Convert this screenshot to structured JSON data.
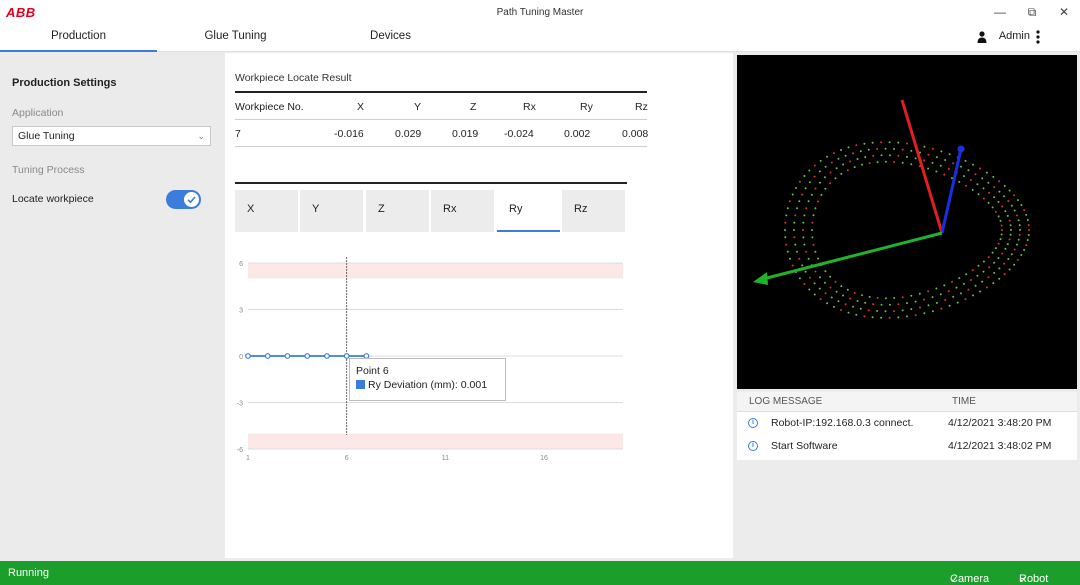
{
  "app": {
    "logo": "ABB",
    "title": "Path Tuning Master"
  },
  "window_controls": {
    "minimize": "—",
    "restore": "⧉",
    "close": "✕"
  },
  "tabs": [
    {
      "label": "Production"
    },
    {
      "label": "Glue Tuning"
    },
    {
      "label": "Devices"
    }
  ],
  "user": {
    "name": "Admin"
  },
  "left": {
    "title": "Production Settings",
    "application_label": "Application",
    "application_value": "Glue Tuning",
    "tuning_label": "Tuning Process",
    "locate_label": "Locate workpiece",
    "locate_on": true
  },
  "result": {
    "title": "Workpiece Locate Result",
    "headers": [
      "Workpiece No.",
      "X",
      "Y",
      "Z",
      "Rx",
      "Ry",
      "Rz"
    ],
    "row": [
      "7",
      "-0.016",
      "0.029",
      "0.019",
      "-0.024",
      "0.002",
      "0.008"
    ]
  },
  "axis_tabs": [
    "X",
    "Y",
    "Z",
    "Rx",
    "Ry",
    "Rz"
  ],
  "axis_tab_active": "Ry",
  "chart_data": {
    "type": "line",
    "series": [
      {
        "name": "Ry Deviation (mm)",
        "values": [
          0,
          0,
          0,
          0,
          0,
          0.001,
          0
        ]
      }
    ],
    "x": [
      1,
      2,
      3,
      4,
      5,
      6,
      7
    ],
    "xticks": [
      "1",
      "6",
      "11",
      "16"
    ],
    "yticks": [
      "6",
      "3",
      "0",
      "-3",
      "-6"
    ],
    "ylim": [
      -6,
      6
    ],
    "xlim": [
      1,
      20
    ],
    "tolerance_bands": [
      [
        5,
        6
      ],
      [
        -6,
        -5
      ]
    ],
    "highlight_x": 6,
    "colors": {
      "line": "#3b7ddd",
      "band": "#fde8e8"
    }
  },
  "tooltip": {
    "title": "Point 6",
    "label": "Ry Deviation (mm): 0.001"
  },
  "log": {
    "headers": [
      "LOG MESSAGE",
      "TIME"
    ],
    "rows": [
      {
        "message": "Robot-IP:192.168.0.3 connect.",
        "time": "4/12/2021 3:48:20 PM"
      },
      {
        "message": "Start Software",
        "time": "4/12/2021 3:48:02 PM"
      }
    ]
  },
  "status": {
    "state": "Running",
    "camera": "Camera",
    "robot": "Robot"
  }
}
